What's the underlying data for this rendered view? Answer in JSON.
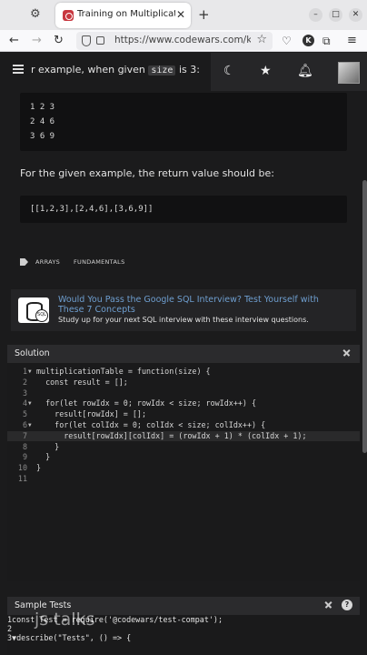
{
  "browser": {
    "tab_title": "Training on Multiplication",
    "url": "https://www.codewars.com/kat",
    "account_initial": "K"
  },
  "kata": {
    "intro_prefix": "r example, when given ",
    "intro_code": "size",
    "intro_suffix": " is 3:",
    "matrix_lines": [
      "1 2 3",
      "2 4 6",
      "3 6 9"
    ],
    "return_text": "For the given example, the return value should be:",
    "return_value": "[[1,2,3],[2,4,6],[3,6,9]]",
    "tags": [
      "ARRAYS",
      "FUNDAMENTALS"
    ]
  },
  "ad": {
    "title": "Would You Pass the Google SQL Interview? Test Yourself with These 7 Concepts",
    "subtitle": "Study up for your next SQL interview with these interview questions."
  },
  "solution": {
    "label": "Solution",
    "lines": [
      {
        "n": "1",
        "fold": "▼",
        "text": "multiplicationTable = function(size) {"
      },
      {
        "n": "2",
        "fold": "",
        "text": "  const result = [];"
      },
      {
        "n": "3",
        "fold": "",
        "text": ""
      },
      {
        "n": "4",
        "fold": "▼",
        "text": "  for(let rowIdx = 0; rowIdx < size; rowIdx++) {"
      },
      {
        "n": "5",
        "fold": "",
        "text": "    result[rowIdx] = [];"
      },
      {
        "n": "6",
        "fold": "▼",
        "text": "    for(let colIdx = 0; colIdx < size; colIdx++) {"
      },
      {
        "n": "7",
        "fold": "",
        "text": "      result[rowIdx][colIdx] = (rowIdx + 1) * (colIdx + 1);"
      },
      {
        "n": "8",
        "fold": "",
        "text": "    }"
      },
      {
        "n": "9",
        "fold": "",
        "text": "  }"
      },
      {
        "n": "10",
        "fold": "",
        "text": "}"
      },
      {
        "n": "11",
        "fold": "",
        "text": ""
      }
    ]
  },
  "sample_tests": {
    "label": "Sample Tests",
    "lines": [
      {
        "n": "1",
        "fold": "",
        "text": "const Test = require('@codewars/test-compat');"
      },
      {
        "n": "2",
        "fold": "",
        "text": ""
      },
      {
        "n": "3",
        "fold": "▼",
        "text": "describe(\"Tests\", () => {"
      }
    ]
  },
  "watermark": "js talks"
}
